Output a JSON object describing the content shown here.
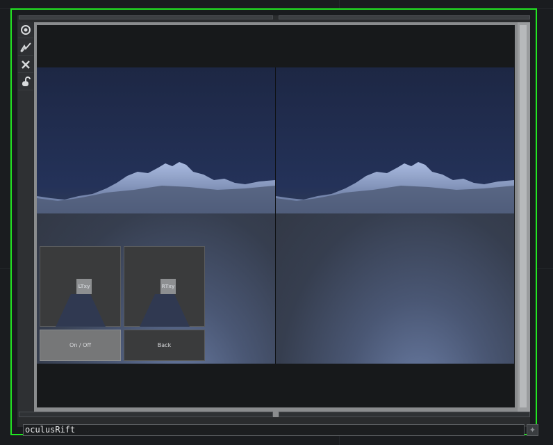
{
  "node": {
    "name": "oculusRift",
    "frame_color": "#22e622"
  },
  "toolbar": {
    "items": [
      {
        "icon": "viewer-toggle-icon"
      },
      {
        "icon": "bypass-icon"
      },
      {
        "icon": "close-icon"
      },
      {
        "icon": "lock-icon"
      }
    ]
  },
  "overlay_ui": {
    "left_stick_label": "LTxy",
    "right_stick_label": "RTxy",
    "on_off_label": "On / Off",
    "back_label": "Back"
  },
  "colors": {
    "sky": "#243259",
    "ground": "#363e4f",
    "terrain": "#8ea2cc"
  }
}
